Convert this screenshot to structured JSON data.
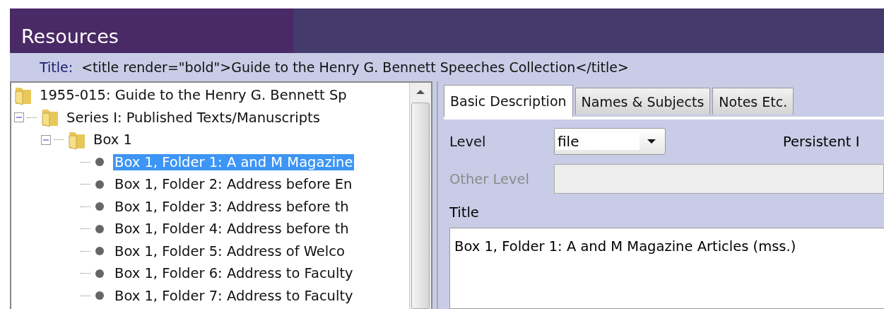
{
  "header": {
    "title": "Resources"
  },
  "title_bar": {
    "label": "Title:",
    "value": "<title render=\"bold\">Guide to the Henry G. Bennett Speeches Collection</title>"
  },
  "tree": [
    {
      "label": "1955-015: Guide to the Henry G. Bennett Sp",
      "kind": "folder",
      "selected": false,
      "children": [
        {
          "label": "Series I: Published Texts/Manuscripts",
          "kind": "folder",
          "selected": false,
          "expanded": true,
          "children": [
            {
              "label": "Box 1",
              "kind": "folder",
              "selected": false,
              "expanded": true,
              "children": [
                {
                  "label": "Box 1, Folder 1: A and M Magazine",
                  "kind": "leaf",
                  "selected": true
                },
                {
                  "label": "Box 1, Folder 2: Address before En",
                  "kind": "leaf",
                  "selected": false
                },
                {
                  "label": "Box 1, Folder 3: Address before th",
                  "kind": "leaf",
                  "selected": false
                },
                {
                  "label": "Box 1, Folder 4: Address before th",
                  "kind": "leaf",
                  "selected": false
                },
                {
                  "label": "Box 1, Folder 5: Address of Welco",
                  "kind": "leaf",
                  "selected": false
                },
                {
                  "label": "Box 1, Folder 6: Address to Faculty",
                  "kind": "leaf",
                  "selected": false
                },
                {
                  "label": "Box 1, Folder 7: Address to Faculty",
                  "kind": "leaf",
                  "selected": false
                }
              ]
            }
          ]
        }
      ]
    }
  ],
  "tabs": [
    {
      "label": "Basic Description",
      "selected": true
    },
    {
      "label": "Names & Subjects",
      "selected": false
    },
    {
      "label": "Notes Etc.",
      "selected": false
    }
  ],
  "form": {
    "level": {
      "label": "Level",
      "value": "file"
    },
    "persistent_id": {
      "label": "Persistent I"
    },
    "other_level": {
      "label": "Other Level",
      "disabled": true
    },
    "title": {
      "label": "Title",
      "value": "Box 1, Folder 1: A and M Magazine Articles (mss.)"
    }
  }
}
